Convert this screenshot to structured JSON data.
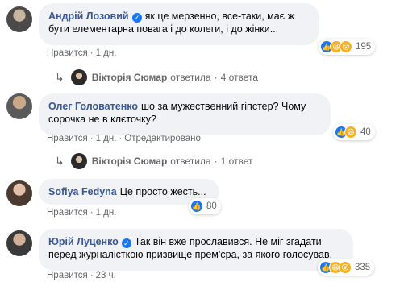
{
  "comments": [
    {
      "author": "Андрій Лозовий",
      "verified": true,
      "text": "як це мерзенно, все-таки, має ж бути елементарна повага і до колеги, і до жінки...",
      "actions": [
        "Нравится",
        "1 дн."
      ],
      "reactions": {
        "icons": [
          "like",
          "haha",
          "wow"
        ],
        "count": "195"
      },
      "replies": {
        "author": "Вікторія Сюмар",
        "verb": "ответила",
        "count": "4 ответа"
      }
    },
    {
      "author": "Олег Головатенко",
      "verified": false,
      "text": "шо за мужественний гіпстер? Чому сорочка не в клєточку?",
      "actions": [
        "Нравится",
        "1 дн.",
        "Отредактировано"
      ],
      "reactions": {
        "icons": [
          "like",
          "haha"
        ],
        "count": "40"
      },
      "replies": {
        "author": "Вікторія Сюмар",
        "verb": "ответила",
        "count": "1 ответ"
      }
    },
    {
      "author": "Sofiya Fedyna",
      "verified": false,
      "text": "Це просто жесть...",
      "actions": [
        "Нравится",
        "1 дн."
      ],
      "reactions": {
        "icons": [
          "like"
        ],
        "count": "80"
      }
    },
    {
      "author": "Юрій Луценко",
      "verified": true,
      "text": "Так він вже прославився. Не міг згадати перед журналісткою призвище прем'єра, за якого голосував.",
      "actions": [
        "Нравится",
        "23 ч."
      ],
      "reactions": {
        "icons": [
          "like",
          "haha",
          "wow"
        ],
        "count": "335"
      }
    }
  ],
  "icons": {
    "like": "thumbs-up-icon",
    "haha": "laughing-face-icon",
    "wow": "surprised-face-icon",
    "reply": "reply-arrow-icon",
    "verified": "verified-check-icon"
  },
  "colors": {
    "author": "#385898",
    "bubble": "#f0f2f5",
    "meta": "#65676b",
    "like": "#1877f2"
  }
}
